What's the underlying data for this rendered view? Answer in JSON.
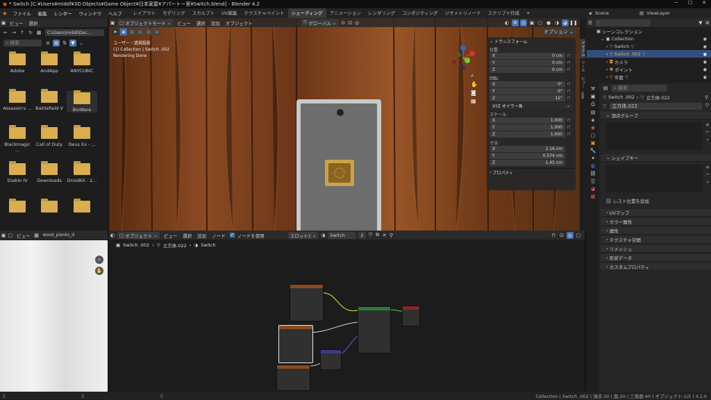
{
  "window": {
    "title": "* Switch [C:¥Users¥middl¥3D Objects¥Game Object¥日本家屋¥アパートー室¥Switch.blend] - Blender 4.2"
  },
  "menu": [
    "ファイル",
    "編集",
    "レンダー",
    "ウィンドウ",
    "ヘルプ"
  ],
  "workspaces": [
    "レイアウト",
    "モデリング",
    "スカルプト",
    "UV編集",
    "テクスチャペイント",
    "シェーディング",
    "アニメーション",
    "レンダリング",
    "コンポジティング",
    "ジオメトリノード",
    "スクリプト作成"
  ],
  "active_workspace": "シェーディング",
  "top_right": {
    "scene": "Scene",
    "view_layer": "ViewLayer"
  },
  "file_browser": {
    "header": [
      "ビュー",
      "選択"
    ],
    "path": "C:\\Users\\middl\\Doc...",
    "search_placeholder": "検索",
    "folders": [
      "Adobe",
      "AndApp",
      "ANYCUBIC",
      "Assassin's ...",
      "Battlefield V",
      "BioWare",
      "Blackmagic ...",
      "Call of Duty",
      "Deus Ex - ...",
      "Diablo IV",
      "Downloads",
      "DroidKit - 2...",
      "",
      "",
      ""
    ]
  },
  "viewport": {
    "mode": "オブジェクトモード",
    "menu": [
      "ビュー",
      "選択",
      "追加",
      "オブジェクト"
    ],
    "transform_orientation": "グローバル",
    "options": "オプション",
    "overlay_lines": [
      "ユーザー・透視投影",
      "(1) Collection | Switch .002",
      "Rendering Done"
    ],
    "side_tabs": [
      "アイテム",
      "ツール",
      "ビュー",
      "VIM"
    ]
  },
  "n_panel": {
    "transform_title": "トランスフォーム",
    "location_label": "位置:",
    "location": [
      {
        "axis": "X",
        "value": "0 cm"
      },
      {
        "axis": "Y",
        "value": "0 cm"
      },
      {
        "axis": "Z",
        "value": "0 cm"
      }
    ],
    "rotation_label": "回転:",
    "rotation": [
      {
        "axis": "X",
        "value": "0°"
      },
      {
        "axis": "Y",
        "value": "0°"
      },
      {
        "axis": "Z",
        "value": "12°"
      }
    ],
    "rotation_mode": "XYZ オイラー角",
    "scale_label": "スケール:",
    "scale": [
      {
        "axis": "X",
        "value": "1.000"
      },
      {
        "axis": "Y",
        "value": "1.000"
      },
      {
        "axis": "Z",
        "value": "1.000"
      }
    ],
    "dimensions_label": "寸法:",
    "dimensions": [
      {
        "axis": "X",
        "value": "2.16 cm"
      },
      {
        "axis": "Y",
        "value": "0.574 cm"
      },
      {
        "axis": "Z",
        "value": "1.45 cm"
      }
    ],
    "properties": "プロパティ"
  },
  "outliner": {
    "root": "シーンコレクション",
    "items": [
      {
        "label": "Collection",
        "indent": 0,
        "selected": false
      },
      {
        "label": "Switch",
        "indent": 1,
        "selected": false
      },
      {
        "label": "Switch .002",
        "indent": 1,
        "selected": true
      },
      {
        "label": "カメラ",
        "indent": 1,
        "selected": false
      },
      {
        "label": "ポイント",
        "indent": 1,
        "selected": false
      },
      {
        "label": "平面",
        "indent": 1,
        "selected": false
      }
    ]
  },
  "properties": {
    "search_placeholder": "検索",
    "breadcrumb": [
      "Switch .002",
      "立方体.022"
    ],
    "mesh_name": "立方体.022",
    "vertex_groups": "頂点グループ",
    "shape_keys": "シェイプキー",
    "rest_position": "レスト位置を追加",
    "sections": [
      "UVマップ",
      "カラー属性",
      "属性",
      "テクスチャ空間",
      "リメッシュ",
      "形状データ",
      "カスタムプロパティ"
    ]
  },
  "image_editor": {
    "view": "ビュー",
    "image_name": "wood_planks_d"
  },
  "node_editor": {
    "header": [
      "オブジェクト",
      "ビュー",
      "選択",
      "追加",
      "ノード"
    ],
    "use_nodes": "ノードを使用",
    "slot": "スロット1",
    "material": "Switch",
    "users": "2",
    "breadcrumb": [
      "Switch .002",
      "立方体.022",
      "Switch"
    ]
  },
  "status": {
    "right": "Collection | Switch .002 | 頂点:30 | 面:20 | 三角面:40 | オブジェクト:1/5 | 4.2.0"
  },
  "colors": {
    "accent": "#4772b3",
    "folder": "#d9ae4f",
    "wood": "#8a4a22",
    "selected_row": "#334d80"
  }
}
